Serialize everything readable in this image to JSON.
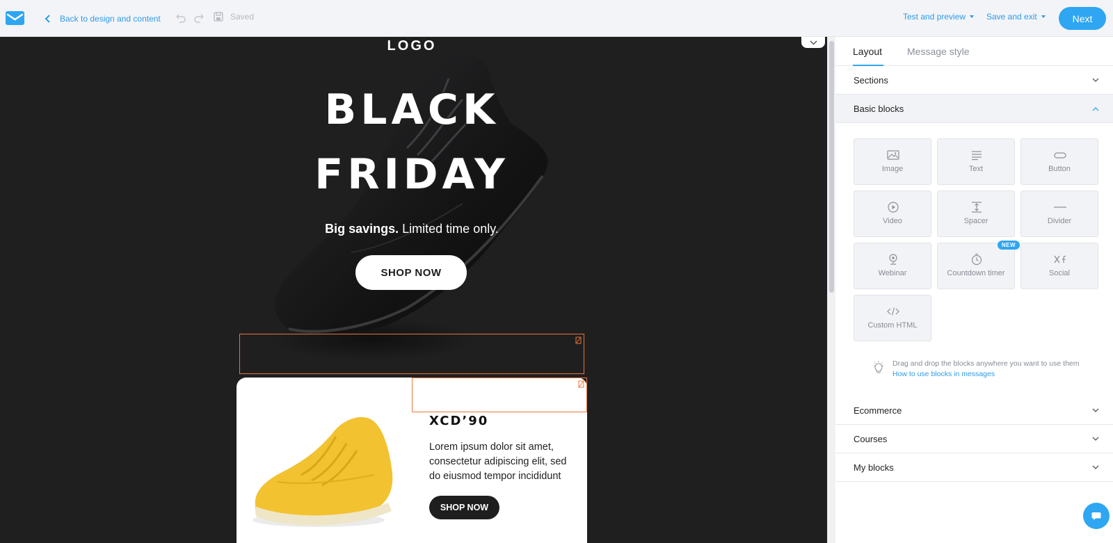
{
  "topbar": {
    "back_label": "Back to design and content",
    "saved_label": "Saved",
    "test_preview_label": "Test and preview",
    "save_exit_label": "Save and exit",
    "next_label": "Next"
  },
  "email": {
    "logo_text": "LOGO",
    "headline_line1": "BLACK",
    "headline_line2": "FRIDAY",
    "tagline_bold": "Big savings.",
    "tagline_rest": " Limited time only.",
    "hero_button": "SHOP NOW",
    "product": {
      "title": "XCD’90",
      "description": "Lorem ipsum dolor sit amet, consectetur adipiscing elit, sed do eiusmod tempor incididunt",
      "button": "SHOP NOW"
    }
  },
  "panel": {
    "tabs": [
      {
        "label": "Layout",
        "active": true
      },
      {
        "label": "Message style",
        "active": false
      }
    ],
    "sections_label": "Sections",
    "basic_blocks_label": "Basic blocks",
    "blocks": [
      {
        "label": "Image",
        "icon": "image-icon"
      },
      {
        "label": "Text",
        "icon": "text-icon"
      },
      {
        "label": "Button",
        "icon": "button-icon"
      },
      {
        "label": "Video",
        "icon": "video-icon"
      },
      {
        "label": "Spacer",
        "icon": "spacer-icon"
      },
      {
        "label": "Divider",
        "icon": "divider-icon"
      },
      {
        "label": "Webinar",
        "icon": "webinar-icon"
      },
      {
        "label": "Countdown timer",
        "icon": "timer-icon"
      },
      {
        "label": "Social",
        "icon": "social-icon"
      },
      {
        "label": "Custom HTML",
        "icon": "code-icon"
      }
    ],
    "new_badge": "NEW",
    "hint_text": "Drag and drop the blocks anywhere you want to use them",
    "hint_link": "How to use blocks in messages",
    "ecommerce_label": "Ecommerce",
    "courses_label": "Courses",
    "my_blocks_label": "My blocks"
  },
  "colors": {
    "accent": "#2ea6f2",
    "canvas_bg": "#1f1f20",
    "selection": "#e8763a",
    "product_yellow": "#f2c230"
  }
}
